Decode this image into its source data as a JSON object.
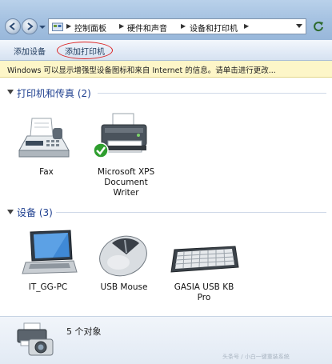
{
  "address_bar": {
    "breadcrumbs": [
      "控制面板",
      "硬件和声音",
      "设备和打印机"
    ]
  },
  "toolbar": {
    "add_device": "添加设备",
    "add_printer": "添加打印机"
  },
  "infobar": {
    "message": "Windows 可以显示增强型设备图标和来自 Internet 的信息。请单击进行更改..."
  },
  "sections": {
    "printers": {
      "title": "打印机和传真 (2)",
      "items": [
        {
          "label": "Fax",
          "icon": "fax-icon"
        },
        {
          "label": "Microsoft XPS\nDocument\nWriter",
          "icon": "xps-printer-icon",
          "default": true
        }
      ]
    },
    "devices": {
      "title": "设备 (3)",
      "items": [
        {
          "label": "IT_GG-PC",
          "icon": "laptop-icon"
        },
        {
          "label": "USB Mouse",
          "icon": "mouse-icon"
        },
        {
          "label": "GASIA USB KB\nPro",
          "icon": "keyboard-icon"
        }
      ]
    }
  },
  "status": {
    "count_text": "5 个对象"
  },
  "watermark": "头条号 / 小白一键重装系统",
  "colors": {
    "section_title": "#1e3f8f",
    "infobar_bg": "#fdf6c8",
    "highlight_circle": "#dd2222"
  }
}
